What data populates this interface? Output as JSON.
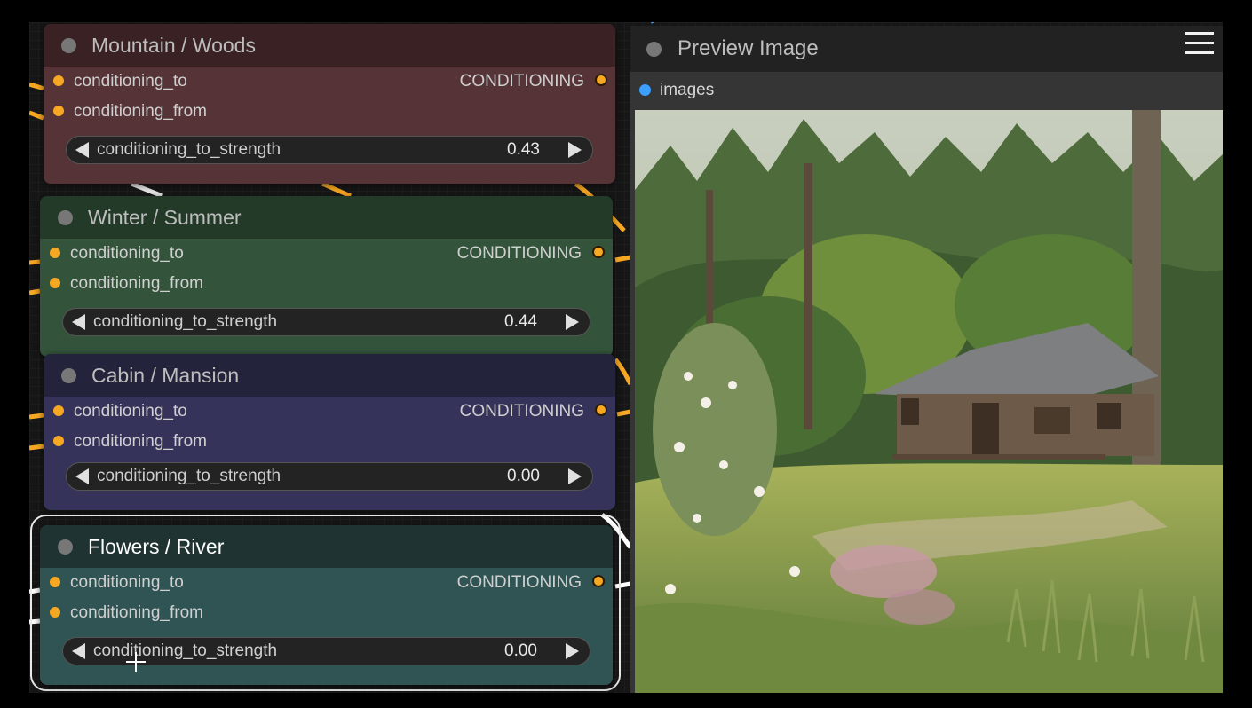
{
  "nodes": [
    {
      "title": "Mountain / Woods",
      "input1": "conditioning_to",
      "input2": "conditioning_from",
      "output": "CONDITIONING",
      "widget_name": "conditioning_to_strength",
      "widget_value": "0.43",
      "color": "#553336",
      "title_color": "#3a2224"
    },
    {
      "title": "Winter / Summer",
      "input1": "conditioning_to",
      "input2": "conditioning_from",
      "output": "CONDITIONING",
      "widget_name": "conditioning_to_strength",
      "widget_value": "0.44",
      "color": "#33533a",
      "title_color": "#233a28"
    },
    {
      "title": "Cabin / Mansion",
      "input1": "conditioning_to",
      "input2": "conditioning_from",
      "output": "CONDITIONING",
      "widget_name": "conditioning_to_strength",
      "widget_value": "0.00",
      "color": "#35335a",
      "title_color": "#23233b"
    },
    {
      "title": "Flowers / River",
      "input1": "conditioning_to",
      "input2": "conditioning_from",
      "output": "CONDITIONING",
      "widget_name": "conditioning_to_strength",
      "widget_value": "0.00",
      "color": "#2f5453",
      "title_color": "#1f3332",
      "selected": true
    }
  ],
  "preview": {
    "title": "Preview Image",
    "input": "images",
    "menu_icon": "hamburger-menu-icon",
    "image_subject": "painting of a wooden cabin in a forest clearing with wildflowers"
  },
  "colors": {
    "conditioning_slot": "#f7a823",
    "image_slot": "#3ba0ff",
    "selected_wire": "#ffffff"
  }
}
